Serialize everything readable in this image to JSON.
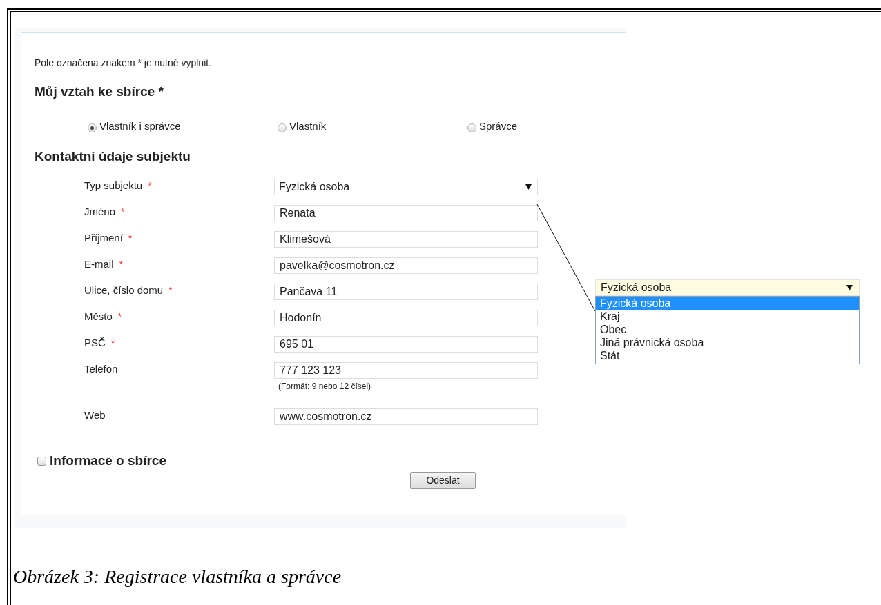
{
  "intro": "Pole označena znakem * je nutné vyplnit.",
  "relation": {
    "title": "Můj vztah ke sbírce *",
    "options": [
      {
        "label": "Vlastník i správce",
        "selected": true
      },
      {
        "label": "Vlastník",
        "selected": false
      },
      {
        "label": "Správce",
        "selected": false
      }
    ]
  },
  "contact": {
    "title": "Kontaktní údaje subjektu",
    "fields": [
      {
        "kind": "select",
        "label": "Typ subjektu",
        "marker": "*",
        "value": "Fyzická osoba"
      },
      {
        "kind": "text",
        "label": "Jméno",
        "marker": "*",
        "value": "Renata"
      },
      {
        "kind": "text",
        "label": "Příjmení",
        "marker": "*",
        "value": "Klimešová"
      },
      {
        "kind": "text",
        "label": "E-mail",
        "marker": "*",
        "value": "pavelka@cosmotron.cz"
      },
      {
        "kind": "text",
        "label": "Ulice, číslo domu",
        "marker": "*",
        "value": "Pančava 11"
      },
      {
        "kind": "text",
        "label": "Město",
        "marker": "*",
        "value": "Hodonín"
      },
      {
        "kind": "text",
        "label": "PSČ",
        "marker": "*",
        "value": "695 01"
      },
      {
        "kind": "text",
        "label": "Telefon",
        "value": "777 123 123",
        "hint": "(Formát: 9 nebo 12 čísel)"
      },
      {
        "kind": "text",
        "label": "Web",
        "value": "www.cosmotron.cz"
      }
    ]
  },
  "info_section": {
    "title": "Informace o sbírce",
    "checked": false
  },
  "submit": "Odeslat",
  "dropdown_popup": {
    "value": "Fyzická osoba",
    "options": [
      {
        "label": "Fyzická osoba",
        "selected": true
      },
      {
        "label": "Kraj",
        "selected": false
      },
      {
        "label": "Obec",
        "selected": false
      },
      {
        "label": "Jiná právnická osoba",
        "selected": false
      },
      {
        "label": "Stát",
        "selected": false
      }
    ]
  },
  "caption": "Obrázek 3: Registrace vlastníka a správce"
}
